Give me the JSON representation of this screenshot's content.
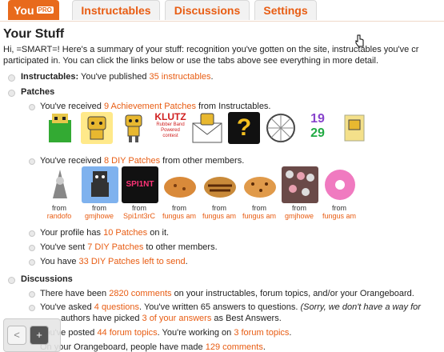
{
  "tabs": [
    {
      "label": "You",
      "badge": "PRO"
    },
    {
      "label": "Instructables"
    },
    {
      "label": "Discussions"
    },
    {
      "label": "Settings"
    }
  ],
  "page_title": "Your Stuff",
  "intro": {
    "line1": "Hi, =SMART=! Here's a summary of your stuff: recognition you've gotten on the site, instructables you've cr",
    "line2": "participated in. You can click the links below or use the tabs above see everything in more detail."
  },
  "instructables": {
    "label": "Instructables:",
    "pre": "You've published",
    "link": "35 instructables",
    "post": "."
  },
  "patches": {
    "heading": "Patches",
    "achievement": {
      "pre": "You've received",
      "link": "9 Achievement Patches",
      "post": "from Instructables."
    },
    "achievement_icons": [
      "robot-green-icon",
      "robot-sign-icon",
      "robot-walk-icon",
      "klutz-icon",
      "robot-envelope-icon",
      "question-icon",
      "wheel-icon",
      "year-1929-icon",
      "robot-box-icon"
    ],
    "klutz_text": "KLUTZ",
    "klutz_sub": "Rubber Band Powered contest",
    "question_mark": "?",
    "year_text": [
      "19",
      "29"
    ],
    "diy": {
      "pre": "You've received",
      "link": "8 DIY Patches",
      "post": "from other members."
    },
    "diy_from_label": "from",
    "diy_patches": [
      {
        "icon": "wizard-icon",
        "from": "randofo"
      },
      {
        "icon": "robot-blue-icon",
        "from": "gmjhowe"
      },
      {
        "icon": "spi1nt-icon",
        "from": "Spi1nt3rC",
        "text": "SPI1NT"
      },
      {
        "icon": "cookie-icon",
        "from": "fungus am"
      },
      {
        "icon": "cookie-stripe-icon",
        "from": "fungus am"
      },
      {
        "icon": "cookie-chip-icon",
        "from": "fungus am"
      },
      {
        "icon": "candy-icon",
        "from": "gmjhowe"
      },
      {
        "icon": "donut-icon",
        "from": "fungus am"
      }
    ],
    "profile": {
      "pre": "Your profile has",
      "link": "10 Patches",
      "post": "on it."
    },
    "sent": {
      "pre": "You've sent",
      "link": "7 DIY Patches",
      "post": "to other members."
    },
    "left": {
      "pre": "You have",
      "link": "33 DIY Patches left to send",
      "post": "."
    }
  },
  "discussions": {
    "heading": "Discussions",
    "comments": {
      "pre": "There have been",
      "link": "2820 comments",
      "post": "on your instructables, forum topics, and/or your Orangeboard."
    },
    "questions": {
      "pre": "You've asked",
      "link": "4 questions",
      "mid": ". You've written 65 answers to questions.",
      "italic": "(Sorry, we don't have a way for"
    },
    "authors": {
      "pre": "authors have picked",
      "link": "3 of your answers",
      "post": "as Best Answers."
    },
    "forum": {
      "pre": "You've posted",
      "link": "44 forum topics",
      "mid": ". You're working on",
      "link2": "3 forum topics",
      "post": "."
    },
    "orangeboard": {
      "pre": "On your Orangeboard, people have made",
      "link": "129 comments",
      "post": "."
    }
  },
  "nav": {
    "back": "<",
    "add": "+"
  },
  "colors": {
    "accent": "#e85c12",
    "tab_active": "#e86a1c"
  }
}
